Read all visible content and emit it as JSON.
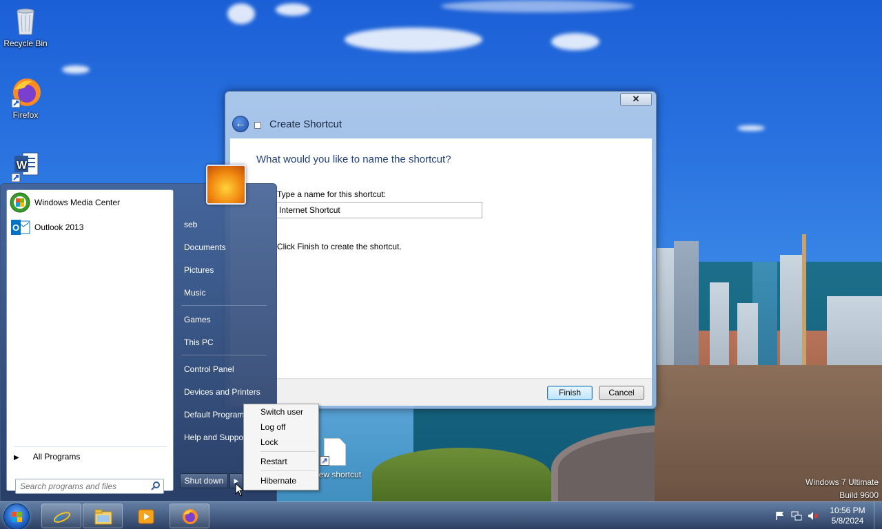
{
  "desktop": {
    "icons": [
      {
        "label": "Recycle Bin",
        "icon": "recycle-bin-icon"
      },
      {
        "label": "Firefox",
        "icon": "firefox-icon"
      },
      {
        "label": "",
        "icon": "word-icon"
      }
    ],
    "new_shortcut_label": "New shortcut",
    "watermark": {
      "line1": "Windows 7 Ultimate",
      "line2": "Build 9600"
    }
  },
  "dialog": {
    "title": "Create Shortcut",
    "close_symbol": "✕",
    "question": "What would you like to name the shortcut?",
    "name_label": "Type a name for this shortcut:",
    "name_value": "Internet Shortcut",
    "hint": "Click Finish to create the shortcut.",
    "finish_label": "Finish",
    "cancel_label": "Cancel"
  },
  "start_menu": {
    "programs": [
      {
        "label": "Windows Media Center",
        "icon": "windows-media-center-icon"
      },
      {
        "label": "Outlook 2013",
        "icon": "outlook-icon"
      }
    ],
    "all_programs": "All Programs",
    "search_placeholder": "Search programs and files",
    "right_items": [
      {
        "label": "seb"
      },
      {
        "label": "Documents"
      },
      {
        "label": "Pictures"
      },
      {
        "label": "Music"
      },
      {
        "label": "Games"
      },
      {
        "label": "This PC"
      },
      {
        "label": "Control Panel"
      },
      {
        "label": "Devices and Printers"
      },
      {
        "label": "Default Programs"
      },
      {
        "label": "Help and Support"
      }
    ],
    "shutdown_label": "Shut down",
    "shutdown_arrow": "▶"
  },
  "shutdown_submenu": {
    "items": [
      "Switch user",
      "Log off",
      "Lock",
      "Restart",
      "Hibernate"
    ]
  },
  "taskbar": {
    "pinned": [
      "internet-explorer-icon",
      "file-explorer-icon",
      "media-player-icon",
      "firefox-icon"
    ],
    "clock_time": "10:56 PM",
    "clock_date": "5/8/2024"
  }
}
